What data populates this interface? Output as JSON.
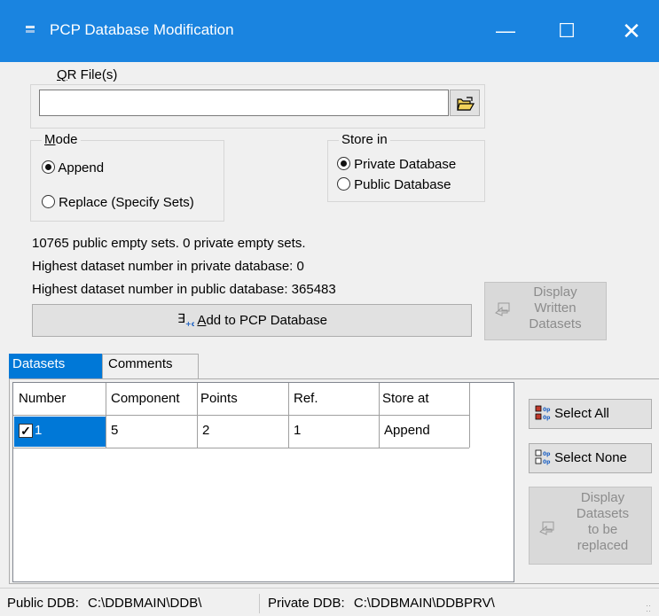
{
  "window": {
    "title": "PCP Database Modification",
    "minimize_glyph": "—",
    "maximize_glyph": "☐",
    "close_glyph": "✕"
  },
  "qr_files": {
    "legend_key": "Q",
    "legend_rest": "R File(s)",
    "value": "",
    "browse_icon": "open-folder-icon"
  },
  "mode": {
    "legend_key": "M",
    "legend_rest": "ode",
    "options": [
      "Append",
      "Replace (Specify Sets)"
    ],
    "selected": "Append"
  },
  "store_in": {
    "legend": "Store in",
    "options": [
      "Private Database",
      "Public Database"
    ],
    "selected": "Private Database"
  },
  "info": [
    "10765 public empty sets. 0 private empty sets.",
    "Highest dataset number in private database: 0",
    "Highest dataset number in public database:  365483"
  ],
  "add_button": {
    "key": "A",
    "rest": "dd to PCP Database",
    "icon": "add-to-db-icon"
  },
  "display_written": {
    "lines": [
      "Display",
      "Written",
      "Datasets"
    ],
    "icon": "display-icon"
  },
  "tabs": [
    "Datasets",
    "Comments"
  ],
  "active_tab": "Datasets",
  "table": {
    "columns": [
      "Number",
      "Component",
      "Points",
      "Ref.",
      "Store at"
    ],
    "rows": [
      {
        "checked": true,
        "number": "1",
        "component": "5",
        "points": "2",
        "ref": "1",
        "store_at": "Append"
      }
    ]
  },
  "select_all": {
    "label": "Select All",
    "icon": "select-all-icon"
  },
  "select_none": {
    "label": "Select None",
    "icon": "select-none-icon"
  },
  "display_replaced": {
    "lines": [
      "Display",
      "Datasets",
      "to be",
      "replaced"
    ],
    "icon": "display-icon"
  },
  "status": {
    "public_label": "Public DDB:",
    "public_value": "C:\\DDBMAIN\\DDB\\",
    "private_label": "Private DDB:",
    "private_value": "C:\\DDBMAIN\\DDBPRV\\"
  },
  "colors": {
    "titlebar": "#1a84e0",
    "selection": "#0078d7",
    "window_bg": "#f0f0f0"
  }
}
